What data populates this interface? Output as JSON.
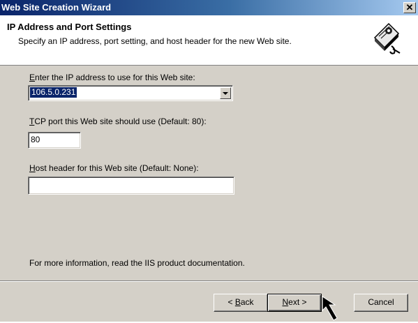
{
  "window": {
    "title": "Web Site Creation Wizard",
    "close_glyph": "✕"
  },
  "header": {
    "title": "IP Address and Port Settings",
    "subtitle": "Specify an IP address, port setting, and host header for the new Web site.",
    "icon": "wizard-book-icon"
  },
  "form": {
    "ip_label": "Enter the IP address to use for this Web site:",
    "ip_label_mnemonic": "E",
    "ip_label_rest": "nter the IP address to use for this Web site:",
    "ip_value": "106.5.0.231",
    "tcp_label_mnemonic": "T",
    "tcp_label_rest": "CP port this Web site should use (Default: 80):",
    "tcp_value": "80",
    "host_label_mnemonic": "H",
    "host_label_rest": "ost header for this Web site (Default: None):",
    "host_value": ""
  },
  "info_text": "For more information, read the IIS product documentation.",
  "buttons": {
    "back_prefix": "< ",
    "back_mnemonic": "B",
    "back_rest": "ack",
    "next_mnemonic": "N",
    "next_rest": "ext >",
    "cancel_label": "Cancel"
  },
  "colors": {
    "titlebar_start": "#0a246a",
    "face": "#d4d0c8",
    "selection": "#0a246a"
  }
}
